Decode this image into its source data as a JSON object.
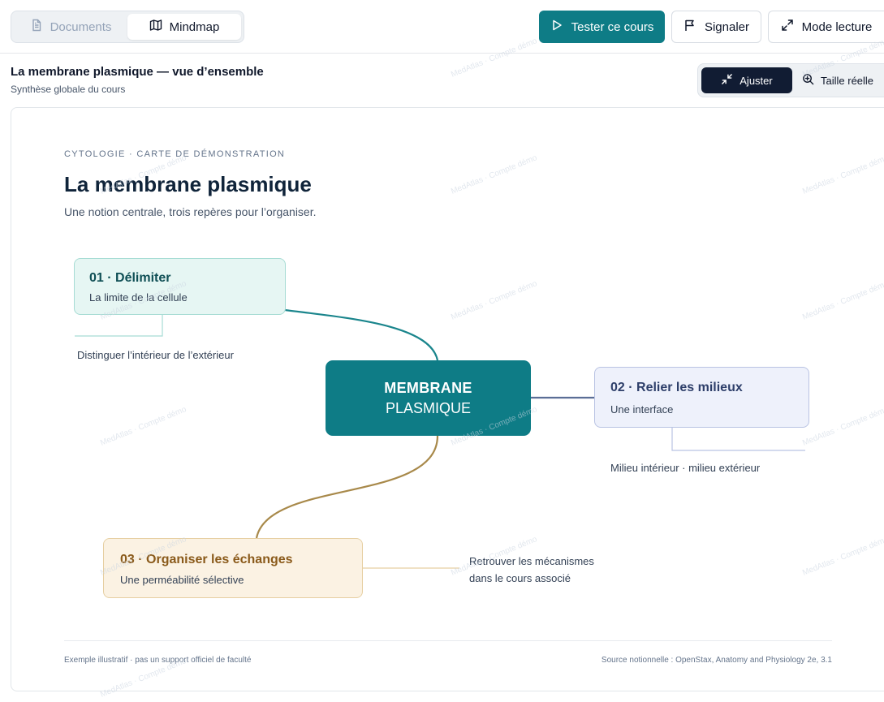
{
  "tabs": {
    "documents": "Documents",
    "mindmap": "Mindmap"
  },
  "toolbar": {
    "test_label": "Tester ce cours",
    "report_label": "Signaler",
    "reading_label": "Mode lecture"
  },
  "header": {
    "title": "La membrane plasmique — vue d’ensemble",
    "subtitle": "Synthèse globale du cours"
  },
  "zoom": {
    "fit_label": "Ajuster",
    "real_label": "Taille réelle"
  },
  "map": {
    "eyebrow": "CYTOLOGIE · CARTE DE DÉMONSTRATION",
    "title": "La membrane plasmique",
    "subtitle": "Une notion centrale, trois repères pour l’organiser.",
    "center": {
      "line1": "MEMBRANE",
      "line2": "PLASMIQUE"
    },
    "branches": [
      {
        "title": "01 · Délimiter",
        "subtitle": "La limite de la cellule",
        "detail": "Distinguer l’intérieur de l’extérieur"
      },
      {
        "title": "02 · Relier les milieux",
        "subtitle": "Une interface",
        "detail": "Milieu intérieur · milieu extérieur"
      },
      {
        "title": "03 · Organiser les échanges",
        "subtitle": "Une perméabilité sélective",
        "detail_line1": "Retrouver les mécanismes",
        "detail_line2": "dans le cours associé"
      }
    ],
    "footer_left": "Exemple illustratif · pas un support officiel de faculté",
    "footer_right": "Source notionnelle : OpenStax, Anatomy and Physiology 2e, 3.1"
  },
  "watermark": "MedAtlas · Compte démo",
  "colors": {
    "accent": "#0e7c86",
    "branch1": "#0e7c86",
    "branch2": "#5b6e96",
    "branch3": "#a8894a",
    "ink": "#10243a"
  }
}
